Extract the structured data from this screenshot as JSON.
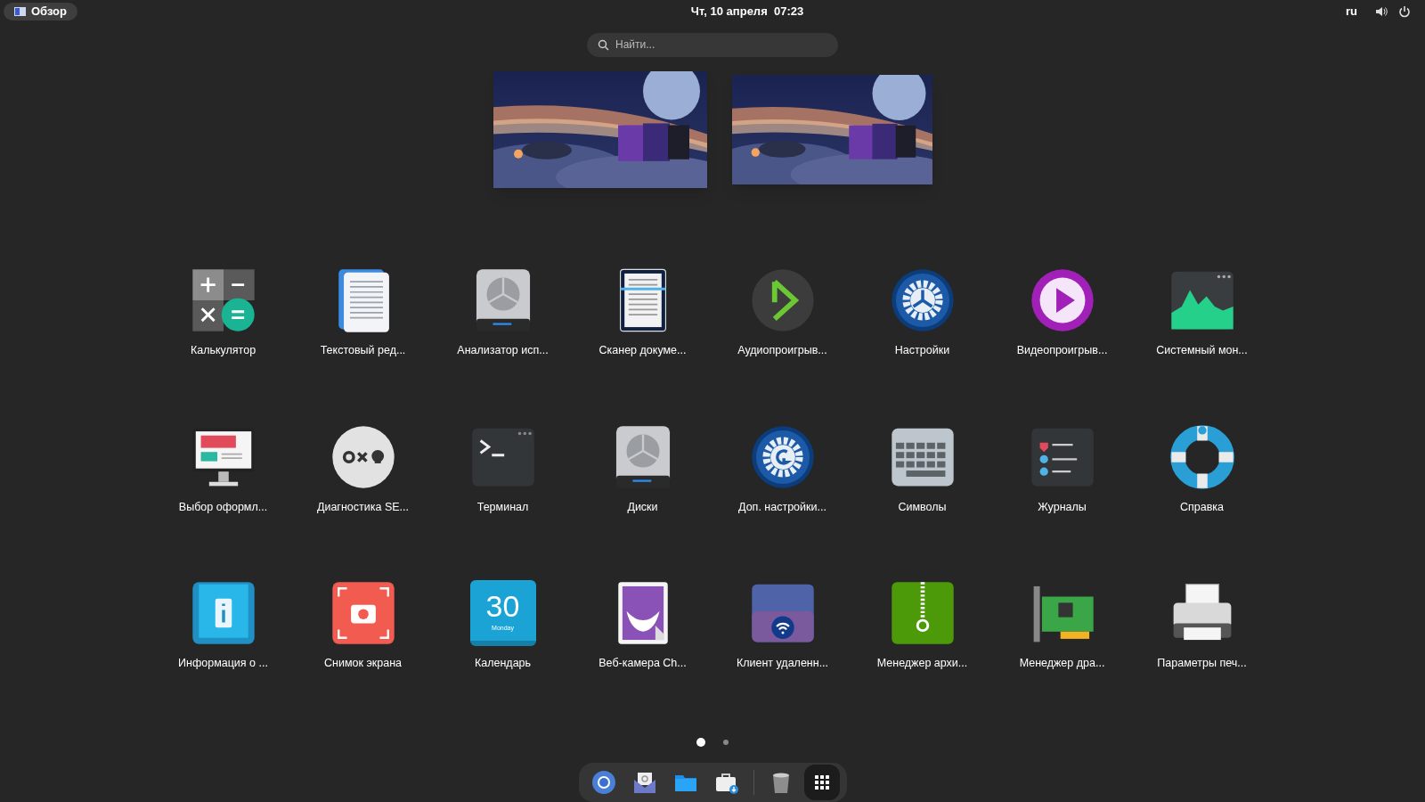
{
  "top_bar": {
    "overview_button": "Обзор",
    "clock": "Чт, 10 апреля  07:23",
    "keyboard_layout": "ru"
  },
  "search": {
    "placeholder": "Найти..."
  },
  "apps": [
    {
      "name": "Калькулятор",
      "kind": "calculator"
    },
    {
      "name": "Текстовый ред...",
      "kind": "text-editor"
    },
    {
      "name": "Анализатор исп...",
      "kind": "disk-analyzer"
    },
    {
      "name": "Сканер докуме...",
      "kind": "scanner"
    },
    {
      "name": "Аудиопроигрыв...",
      "kind": "audio-player"
    },
    {
      "name": "Настройки",
      "kind": "settings"
    },
    {
      "name": "Видеопроигрыв...",
      "kind": "video-player"
    },
    {
      "name": "Системный мон...",
      "kind": "system-monitor"
    },
    {
      "name": "Выбор оформл...",
      "kind": "appearance"
    },
    {
      "name": "Диагностика SE...",
      "kind": "diagnostics"
    },
    {
      "name": "Терминал",
      "kind": "terminal"
    },
    {
      "name": "Диски",
      "kind": "disks"
    },
    {
      "name": "Доп. настройки...",
      "kind": "tweaks"
    },
    {
      "name": "Символы",
      "kind": "characters"
    },
    {
      "name": "Журналы",
      "kind": "logs"
    },
    {
      "name": "Справка",
      "kind": "help"
    },
    {
      "name": "Информация о ...",
      "kind": "info"
    },
    {
      "name": "Снимок экрана",
      "kind": "screenshot"
    },
    {
      "name": "Календарь",
      "kind": "calendar",
      "icon_text": [
        "30",
        "Monday"
      ]
    },
    {
      "name": "Веб-камера Ch...",
      "kind": "webcam"
    },
    {
      "name": "Клиент удаленн...",
      "kind": "remote"
    },
    {
      "name": "Менеджер архи...",
      "kind": "archive"
    },
    {
      "name": "Менеджер дра...",
      "kind": "driver"
    },
    {
      "name": "Параметры печ...",
      "kind": "printer"
    }
  ],
  "pages": [
    {
      "selected": true
    },
    {
      "selected": false
    }
  ],
  "dock": [
    {
      "kind": "browser",
      "selected": false
    },
    {
      "kind": "mail",
      "selected": false
    },
    {
      "kind": "files",
      "selected": false
    },
    {
      "kind": "software",
      "selected": false
    },
    {
      "kind": "separator"
    },
    {
      "kind": "trash",
      "selected": false
    },
    {
      "kind": "app-grid",
      "selected": true
    }
  ]
}
